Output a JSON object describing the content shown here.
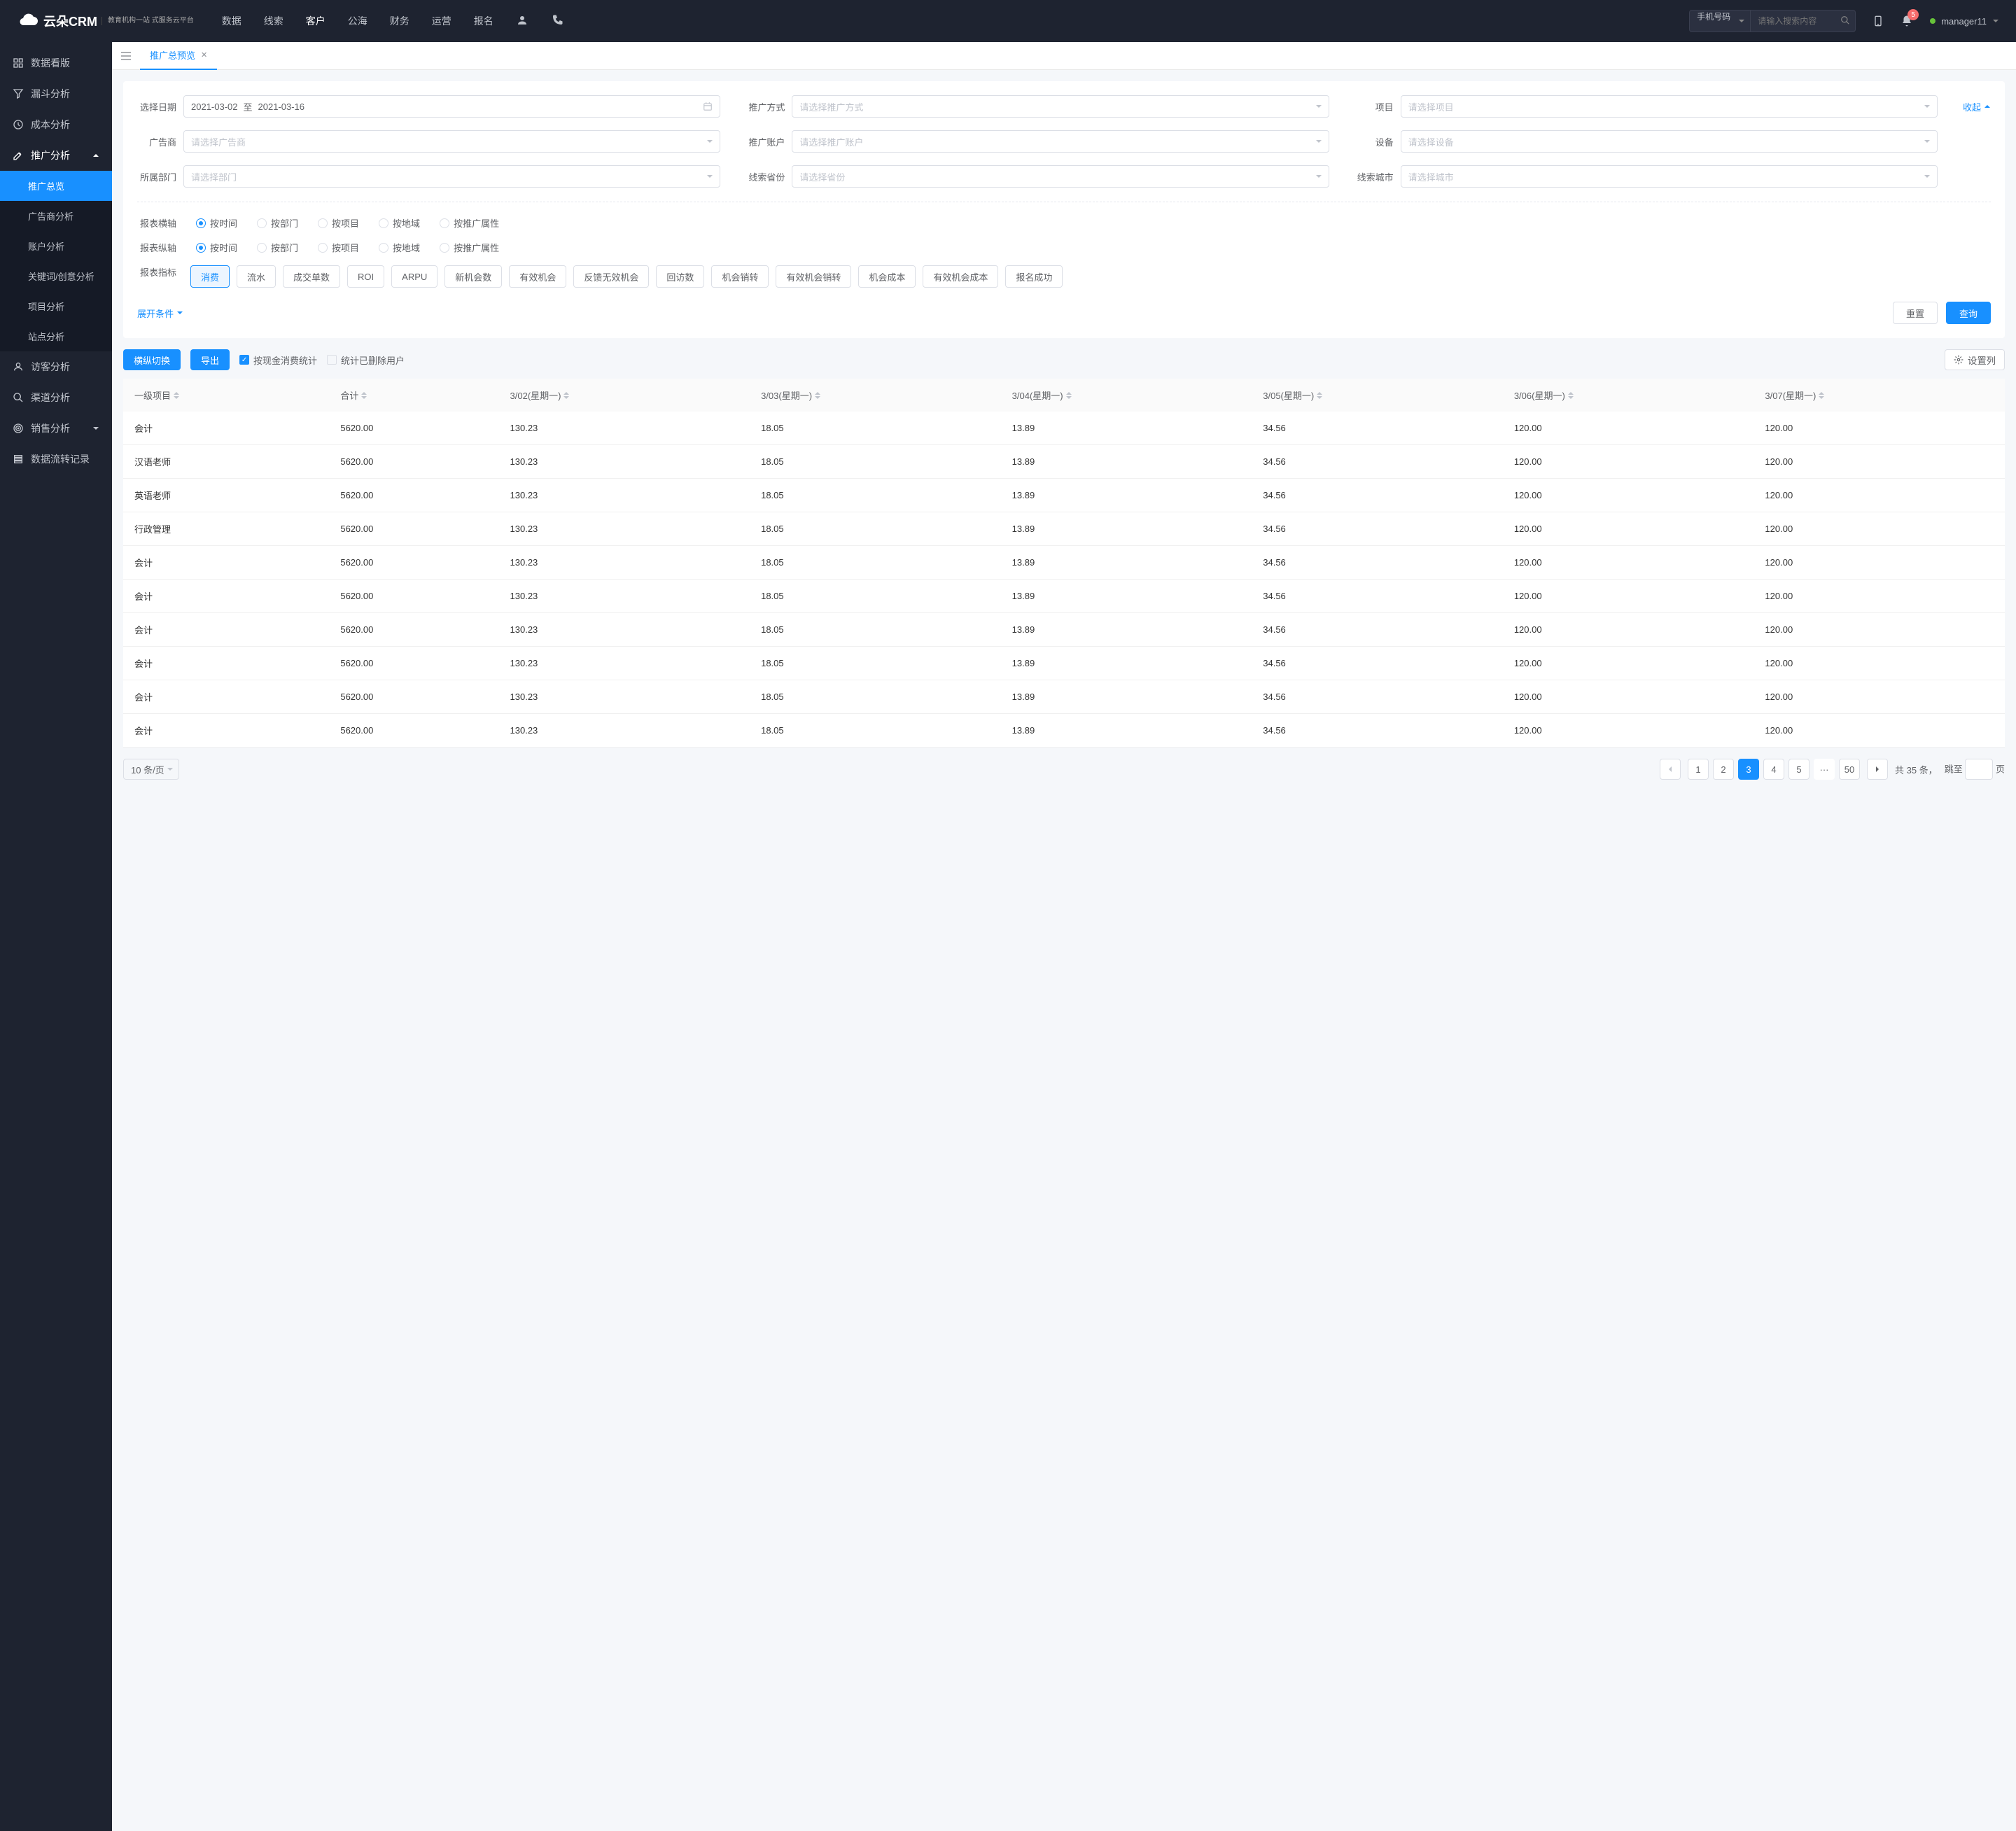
{
  "logo": {
    "name": "云朵CRM",
    "tagline": "教育机构一站\n式服务云平台"
  },
  "topnav": {
    "items": [
      "数据",
      "线索",
      "客户",
      "公海",
      "财务",
      "运营",
      "报名"
    ],
    "active_index": 2,
    "search_type": "手机号码",
    "search_placeholder": "请输入搜索内容",
    "badge_count": "5",
    "username": "manager11"
  },
  "sidebar": {
    "groups": [
      {
        "icon": "dashboard",
        "label": "数据看版",
        "expanded": false
      },
      {
        "icon": "funnel",
        "label": "漏斗分析",
        "expanded": false
      },
      {
        "icon": "clock",
        "label": "成本分析",
        "expanded": false
      },
      {
        "icon": "edit",
        "label": "推广分析",
        "expanded": true,
        "children": [
          "推广总览",
          "广告商分析",
          "账户分析",
          "关键词/创意分析",
          "项目分析",
          "站点分析"
        ],
        "active_child": 0
      },
      {
        "icon": "user",
        "label": "访客分析",
        "expanded": false
      },
      {
        "icon": "search",
        "label": "渠道分析",
        "expanded": false
      },
      {
        "icon": "target",
        "label": "销售分析",
        "expanded": false,
        "has_chevron": true
      },
      {
        "icon": "layers",
        "label": "数据流转记录",
        "expanded": false
      }
    ]
  },
  "tab": {
    "label": "推广总预览"
  },
  "filters": {
    "date_label": "选择日期",
    "date_from": "2021-03-02",
    "date_sep": "至",
    "date_to": "2021-03-16",
    "method_label": "推广方式",
    "method_placeholder": "请选择推广方式",
    "project_label": "项目",
    "project_placeholder": "请选择项目",
    "advertiser_label": "广告商",
    "advertiser_placeholder": "请选择广告商",
    "account_label": "推广账户",
    "account_placeholder": "请选择推广账户",
    "device_label": "设备",
    "device_placeholder": "请选择设备",
    "dept_label": "所属部门",
    "dept_placeholder": "请选择部门",
    "province_label": "线索省份",
    "province_placeholder": "请选择省份",
    "city_label": "线索城市",
    "city_placeholder": "请选择城市",
    "collapse": "收起"
  },
  "axes": {
    "x_label": "报表横轴",
    "y_label": "报表纵轴",
    "options": [
      "按时间",
      "按部门",
      "按项目",
      "按地域",
      "按推广属性"
    ],
    "x_selected": 0,
    "y_selected": 0
  },
  "metrics": {
    "label": "报表指标",
    "items": [
      "消费",
      "流水",
      "成交单数",
      "ROI",
      "ARPU",
      "新机会数",
      "有效机会",
      "反馈无效机会",
      "回访数",
      "机会销转",
      "有效机会销转",
      "机会成本",
      "有效机会成本",
      "报名成功"
    ],
    "selected": 0
  },
  "action": {
    "expand": "展开条件",
    "reset": "重置",
    "query": "查询"
  },
  "toolbar": {
    "switch_btn": "横纵切换",
    "export_btn": "导出",
    "cash_checkbox": "按现金消费统计",
    "cash_checked": true,
    "deleted_checkbox": "统计已删除用户",
    "deleted_checked": false,
    "settings_btn": "设置列"
  },
  "table": {
    "headers": [
      "一级项目",
      "合计",
      "3/02(星期一)",
      "3/03(星期一)",
      "3/04(星期一)",
      "3/05(星期一)",
      "3/06(星期一)",
      "3/07(星期一)"
    ],
    "rows": [
      [
        "会计",
        "5620.00",
        "130.23",
        "18.05",
        "13.89",
        "34.56",
        "120.00",
        "120.00"
      ],
      [
        "汉语老师",
        "5620.00",
        "130.23",
        "18.05",
        "13.89",
        "34.56",
        "120.00",
        "120.00"
      ],
      [
        "英语老师",
        "5620.00",
        "130.23",
        "18.05",
        "13.89",
        "34.56",
        "120.00",
        "120.00"
      ],
      [
        "行政管理",
        "5620.00",
        "130.23",
        "18.05",
        "13.89",
        "34.56",
        "120.00",
        "120.00"
      ],
      [
        "会计",
        "5620.00",
        "130.23",
        "18.05",
        "13.89",
        "34.56",
        "120.00",
        "120.00"
      ],
      [
        "会计",
        "5620.00",
        "130.23",
        "18.05",
        "13.89",
        "34.56",
        "120.00",
        "120.00"
      ],
      [
        "会计",
        "5620.00",
        "130.23",
        "18.05",
        "13.89",
        "34.56",
        "120.00",
        "120.00"
      ],
      [
        "会计",
        "5620.00",
        "130.23",
        "18.05",
        "13.89",
        "34.56",
        "120.00",
        "120.00"
      ],
      [
        "会计",
        "5620.00",
        "130.23",
        "18.05",
        "13.89",
        "34.56",
        "120.00",
        "120.00"
      ],
      [
        "会计",
        "5620.00",
        "130.23",
        "18.05",
        "13.89",
        "34.56",
        "120.00",
        "120.00"
      ]
    ]
  },
  "pagination": {
    "page_size": "10 条/页",
    "pages": [
      "1",
      "2",
      "3",
      "4",
      "5"
    ],
    "ellipsis": "···",
    "last": "50",
    "active": 2,
    "total_prefix": "共 ",
    "total_count": "35",
    "total_suffix": " 条，",
    "jump_prefix": "跳至",
    "jump_suffix": "页"
  }
}
